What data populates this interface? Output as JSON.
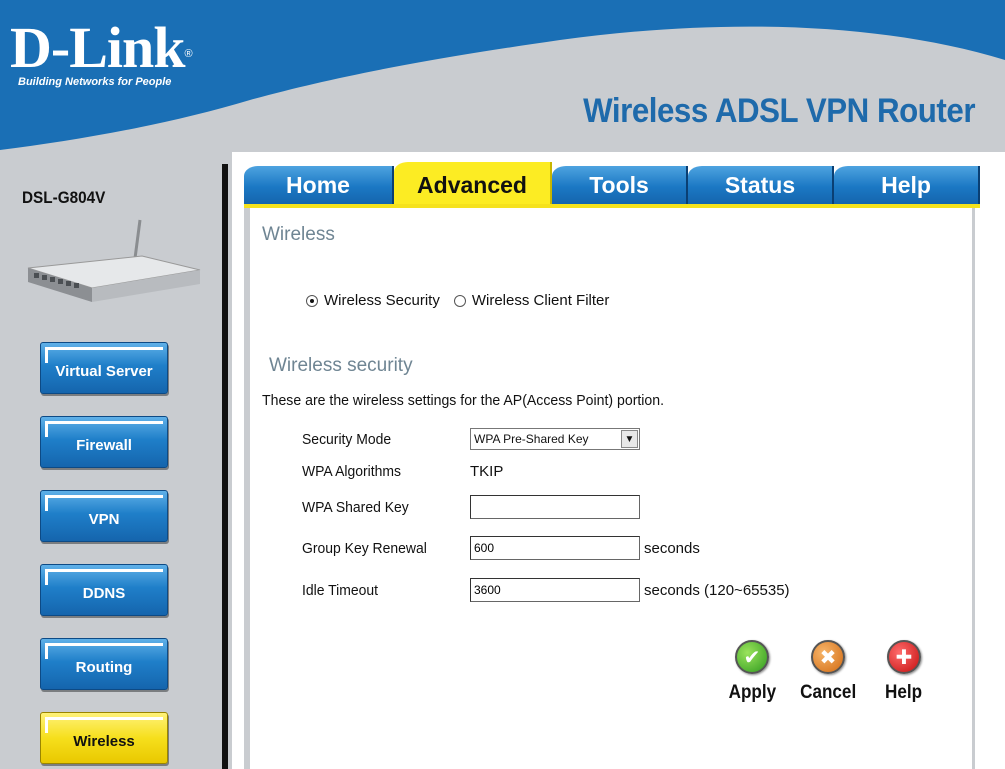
{
  "header": {
    "brand": "D-Link",
    "slogan": "Building Networks for People",
    "product_title": "Wireless ADSL VPN Router"
  },
  "sidebar": {
    "model": "DSL-G804V",
    "items": [
      {
        "label": "Virtual Server",
        "active": false
      },
      {
        "label": "Firewall",
        "active": false
      },
      {
        "label": "VPN",
        "active": false
      },
      {
        "label": "DDNS",
        "active": false
      },
      {
        "label": "Routing",
        "active": false
      },
      {
        "label": "Wireless",
        "active": true
      }
    ]
  },
  "tabs": [
    {
      "label": "Home",
      "active": false
    },
    {
      "label": "Advanced",
      "active": true
    },
    {
      "label": "Tools",
      "active": false
    },
    {
      "label": "Status",
      "active": false
    },
    {
      "label": "Help",
      "active": false
    }
  ],
  "content": {
    "heading": "Wireless",
    "radio": {
      "security": {
        "label": "Wireless Security",
        "checked": true
      },
      "client_filter": {
        "label": "Wireless Client Filter",
        "checked": false
      }
    },
    "subheading": "Wireless security",
    "description": "These are the wireless settings for the AP(Access Point) portion.",
    "form": {
      "security_mode": {
        "label": "Security Mode",
        "value": "WPA Pre-Shared Key"
      },
      "wpa_algorithms": {
        "label": "WPA Algorithms",
        "value": "TKIP"
      },
      "wpa_shared_key": {
        "label": "WPA Shared Key",
        "value": ""
      },
      "group_key_renewal": {
        "label": "Group Key Renewal",
        "value": "600",
        "suffix": "seconds"
      },
      "idle_timeout": {
        "label": "Idle Timeout",
        "value": "3600",
        "suffix": "seconds (120~65535)"
      }
    },
    "actions": {
      "apply": "Apply",
      "cancel": "Cancel",
      "help": "Help"
    }
  },
  "colors": {
    "header_bg": "#c9ccd0",
    "banner_blue": "#1a6fb5",
    "title_blue": "#1e6aab",
    "active_yellow": "#fcec23",
    "heading_gray": "#6f8593"
  }
}
